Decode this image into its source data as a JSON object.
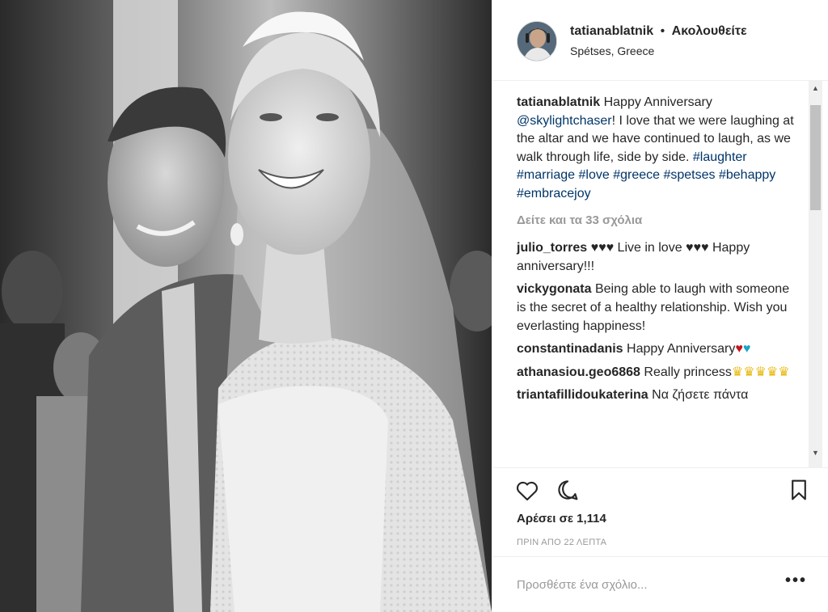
{
  "photo": {
    "description_icon": "wedding-photo"
  },
  "header": {
    "username": "tatianablatnik",
    "separator": "•",
    "follow_label": "Ακολουθείτε",
    "location": "Spétses, Greece"
  },
  "caption": {
    "username": "tatianablatnik",
    "text_1": "Happy Anniversary",
    "mention": "@skylightchaser",
    "text_2": "! I love that we were laughing at the altar and we have continued to laugh, as we walk through life, side by side.",
    "tags": [
      "#laughter",
      "#marriage",
      "#love",
      "#greece",
      "#spetses",
      "#behappy",
      "#embracejoy"
    ]
  },
  "view_all": "Δείτε και τα 33 σχόλια",
  "comments": [
    {
      "user": "julio_torres",
      "text": "♥♥♥ Live in love ♥♥♥ Happy anniversary!!!"
    },
    {
      "user": "vickygonata",
      "text": "Being able to laugh with someone is the secret of a healthy relationship. Wish you everlasting happiness!"
    },
    {
      "user": "constantinadanis",
      "text": "Happy Anniversary",
      "hearts": [
        "♥",
        "♥"
      ]
    },
    {
      "user": "athanasiou.geo6868",
      "text": "Really princess",
      "crowns": "♛♛♛♛♛"
    },
    {
      "user": "triantafillidoukaterina",
      "text": "Να ζήσετε πάντα"
    }
  ],
  "actions": {
    "like_icon": "heart-icon",
    "comment_icon": "comment-icon",
    "save_icon": "bookmark-icon",
    "likes": "Αρέσει σε 1,114",
    "time": "ΠΡΙΝ ΑΠΟ 22 ΛΕΠΤΑ"
  },
  "add_comment": {
    "placeholder": "Προσθέστε ένα σχόλιο...",
    "more": "•••"
  },
  "colors": {
    "link": "#003569",
    "muted": "#999999",
    "text": "#262626"
  }
}
